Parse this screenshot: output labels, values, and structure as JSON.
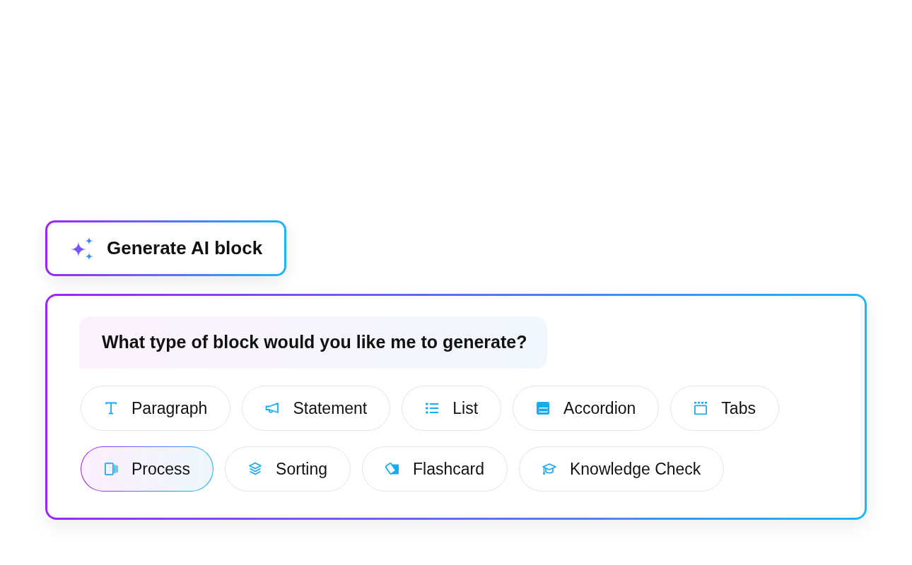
{
  "generate_button": {
    "label": "Generate AI block"
  },
  "panel": {
    "prompt": "What type of block would you like me to generate?",
    "options": [
      {
        "label": "Paragraph",
        "selected": false
      },
      {
        "label": "Statement",
        "selected": false
      },
      {
        "label": "List",
        "selected": false
      },
      {
        "label": "Accordion",
        "selected": false
      },
      {
        "label": "Tabs",
        "selected": false
      },
      {
        "label": "Process",
        "selected": true
      },
      {
        "label": "Sorting",
        "selected": false
      },
      {
        "label": "Flashcard",
        "selected": false
      },
      {
        "label": "Knowledge Check",
        "selected": false
      }
    ]
  }
}
